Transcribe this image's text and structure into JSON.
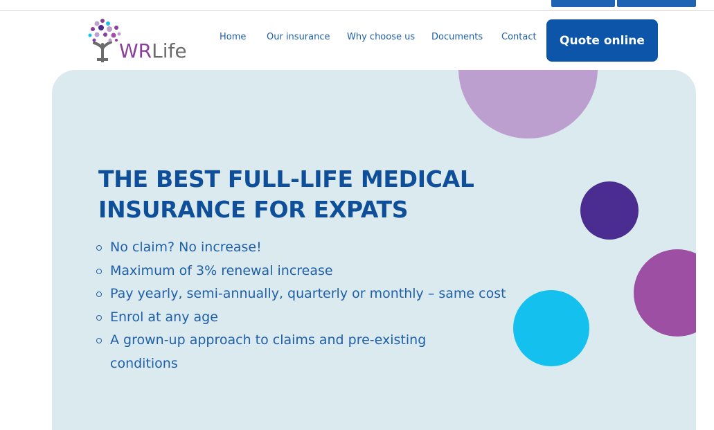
{
  "header": {
    "logo": {
      "brand_wr": "WR",
      "brand_life": "Life"
    },
    "nav": [
      {
        "label": "Home"
      },
      {
        "label": "Our insurance"
      },
      {
        "label": "Why choose us"
      },
      {
        "label": "Documents"
      },
      {
        "label": "Contact"
      }
    ],
    "cta_label": "Quote online"
  },
  "hero": {
    "headline_line1": "THE BEST FULL-LIFE MEDICAL",
    "headline_line2": "INSURANCE FOR EXPATS",
    "bullets": [
      "No claim? No increase!",
      "Maximum of 3% renewal increase",
      "Pay yearly, semi-annually, quarterly or monthly – same cost",
      "Enrol at any age",
      "A grown-up approach to claims and pre-existing conditions"
    ]
  },
  "colors": {
    "primary_blue": "#0d55a8",
    "hero_bg": "#daeaee",
    "circle_lilac": "#bd9fcf",
    "circle_indigo": "#4b2d91",
    "circle_purple": "#9c4fa3",
    "circle_cyan": "#14c0ee"
  }
}
